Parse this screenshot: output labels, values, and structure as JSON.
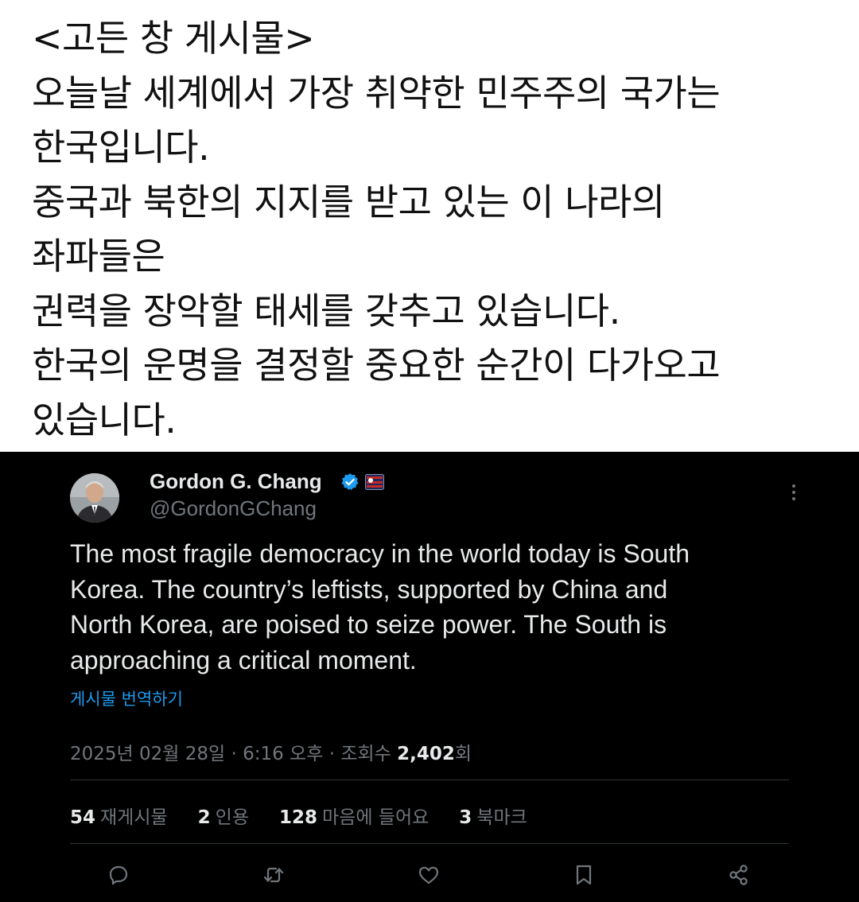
{
  "caption": {
    "lines": [
      "<고든 창 게시물>",
      "오늘날 세계에서 가장 취약한 민주주의 국가는",
      "한국입니다.",
      "중국과 북한의 지지를 받고 있는 이 나라의",
      "좌파들은",
      "권력을 장악할 태세를 갖추고 있습니다.",
      "한국의 운명을 결정할 중요한 순간이 다가오고",
      "있습니다."
    ]
  },
  "tweet": {
    "author": {
      "display_name": "Gordon G. Chang",
      "handle": "@GordonGChang"
    },
    "text_lines": [
      "The most fragile democracy in the world today is South",
      "Korea. The country’s leftists, supported by China and",
      "North Korea, are poised to seize power. The South is",
      "approaching a critical moment."
    ],
    "translate_label": "게시물 번역하기",
    "timestamp": "2025년 02월 28일 · 6:16 오후 · 조회수 ",
    "views_count": "2,402",
    "views_suffix": "회",
    "stats": {
      "reposts": {
        "count": "54",
        "label": "재게시물"
      },
      "quotes": {
        "count": "2",
        "label": "인용"
      },
      "likes": {
        "count": "128",
        "label": "마음에 들어요"
      },
      "bookmarks": {
        "count": "3",
        "label": "북마크"
      }
    },
    "icons": {
      "verified": "verified-badge-icon",
      "affiliate": "affiliate-badge-icon",
      "more": "more-options-icon",
      "reply": "reply-icon",
      "retweet": "retweet-icon",
      "like": "heart-icon",
      "bookmark": "bookmark-icon",
      "share": "share-icon"
    },
    "colors": {
      "background": "#000000",
      "text": "#e7e9ea",
      "secondary": "#71767b",
      "link": "#1d9bf0",
      "verified": "#1d9bf0"
    }
  }
}
